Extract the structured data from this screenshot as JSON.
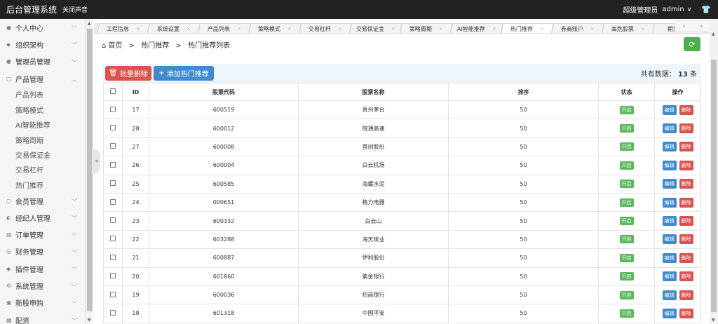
{
  "header": {
    "brand": "后台管理系统",
    "mute_label": "关闭声音",
    "role": "超级管理员",
    "user": "admin"
  },
  "sidebar": {
    "groups": [
      {
        "label": "个人中心",
        "icon": "user-icon"
      },
      {
        "label": "组织架构",
        "icon": "org-icon"
      },
      {
        "label": "管理员管理",
        "icon": "admin-icon"
      },
      {
        "label": "产品管理",
        "icon": "box-icon",
        "expanded": true
      },
      {
        "label": "会员管理",
        "icon": "member-icon"
      },
      {
        "label": "经纪人管理",
        "icon": "agent-icon"
      },
      {
        "label": "订单管理",
        "icon": "order-icon"
      },
      {
        "label": "财务管理",
        "icon": "finance-icon"
      },
      {
        "label": "插件管理",
        "icon": "plugin-icon"
      },
      {
        "label": "系统管理",
        "icon": "settings-icon"
      },
      {
        "label": "新股申购",
        "icon": "ipo-icon"
      },
      {
        "label": "配资",
        "icon": "margin-icon"
      }
    ],
    "sub_items": [
      "产品列表",
      "策略模式",
      "AI智能推荐",
      "策略周期",
      "交易保证金",
      "交易杠杆",
      "热门推荐"
    ]
  },
  "tabs": [
    "工程信息",
    "系统设置",
    "产品列表",
    "策略模式",
    "交易杠杆",
    "交易保证金",
    "策略周期",
    "AI智能推荐",
    "热门推荐",
    "券商账户",
    "高危股票",
    "期货"
  ],
  "active_tab": "热门推荐",
  "breadcrumb": {
    "home": "首页",
    "level1": "热门推荐",
    "level2": "热门推荐列表"
  },
  "toolbar": {
    "batch_delete": "批量删除",
    "add": "添加热门推荐",
    "total_label": "共有数据：",
    "total_count": "13",
    "total_unit": "条"
  },
  "table": {
    "headers": [
      "ID",
      "股票代码",
      "股票名称",
      "排序",
      "状态",
      "操作"
    ],
    "edit_label": "编辑",
    "delete_label": "删除",
    "rows": [
      {
        "id": "17",
        "code": "600519",
        "name": "贵州茅台",
        "sort": "50",
        "status": "开启"
      },
      {
        "id": "28",
        "code": "600012",
        "name": "皖通高速",
        "sort": "50",
        "status": "开启"
      },
      {
        "id": "27",
        "code": "600008",
        "name": "首创股份",
        "sort": "50",
        "status": "开启"
      },
      {
        "id": "26",
        "code": "600004",
        "name": "白云机场",
        "sort": "50",
        "status": "开启"
      },
      {
        "id": "25",
        "code": "600585",
        "name": "海螺水泥",
        "sort": "50",
        "status": "开启"
      },
      {
        "id": "24",
        "code": "000651",
        "name": "格力电器",
        "sort": "50",
        "status": "开启"
      },
      {
        "id": "23",
        "code": "600332",
        "name": "白云山",
        "sort": "50",
        "status": "开启"
      },
      {
        "id": "22",
        "code": "603288",
        "name": "海天味业",
        "sort": "50",
        "status": "开启"
      },
      {
        "id": "21",
        "code": "600887",
        "name": "伊利股份",
        "sort": "50",
        "status": "开启"
      },
      {
        "id": "20",
        "code": "601860",
        "name": "紫金银行",
        "sort": "50",
        "status": "开启"
      },
      {
        "id": "19",
        "code": "600036",
        "name": "招商银行",
        "sort": "50",
        "status": "开启"
      },
      {
        "id": "18",
        "code": "601318",
        "name": "中国平安",
        "sort": "50",
        "status": "开启"
      }
    ]
  },
  "colors": {
    "topbar": "#222222",
    "danger": "#d9534f",
    "primary": "#428bca",
    "success": "#5cb85c"
  }
}
